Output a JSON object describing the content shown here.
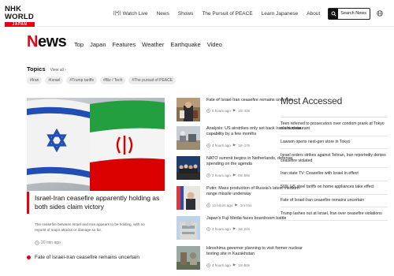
{
  "brand": {
    "logo_main": "NHK WORLD",
    "logo_sub": "JAPAN"
  },
  "topnav": {
    "watch_live": "Watch Live",
    "items": [
      "News",
      "Shows",
      "The Pursuit of PEACE",
      "Learn Japanese",
      "About"
    ],
    "search_label": "Search News"
  },
  "page": {
    "title_first": "N",
    "title_rest": "ews"
  },
  "categories": [
    "Top",
    "Japan",
    "Features",
    "Weather",
    "Earthquake",
    "Video"
  ],
  "topics": {
    "title": "Topics",
    "view_all": "View all",
    "tags": [
      "#Iran",
      "#Israel",
      "#Trump tariffs",
      "#Biz / Tech",
      "#The pursuit of PEACE"
    ]
  },
  "featured": {
    "title": "Israel-Iran ceasefire apparently holding as both sides claim victory",
    "summary": "The ceasefire between Israel and Iran appears to be holding, with no reports of major attacks or damage so far.",
    "time": "20 min ago",
    "related": "Fate of Israel-Iran ceasefire remains uncertain"
  },
  "stories": [
    {
      "title": "Fate of Israel-Iran ceasefire remains uncertain",
      "ago": "6 hours ago",
      "duration": "1m 43s",
      "thumb": "press-conference"
    },
    {
      "title": "Analysis: US airstrikes only set back Iran's nuclear capability by a few months",
      "ago": "4 hours ago",
      "duration": "1m 17s",
      "thumb": "nuclear-facility"
    },
    {
      "title": "NATO summit begins in Netherlands, defense spending on the agenda",
      "ago": "2 hours ago",
      "duration": "0m 59s",
      "thumb": "summit-leaders"
    },
    {
      "title": "Putin: Mass production of Russia's latest medium-range missile underway",
      "ago": "12 hours ago",
      "duration": "1m 01s",
      "thumb": "putin-flags"
    },
    {
      "title": "Japan's Fuji Media faces boardroom battle",
      "ago": "3 hours ago",
      "duration": "1m 24s",
      "thumb": "fuji-building"
    },
    {
      "title": "Hiroshima governor planning to visit former nuclear testing site in Kazakhstan",
      "ago": "4 hours ago",
      "duration": "1m 50s",
      "thumb": "governor-dome"
    }
  ],
  "most_accessed": {
    "title": "Most Accessed",
    "items": [
      "Teen referred to prosecutors over condom prank at Tokyo sushi restaurant",
      "Lawson opens next-gen store in Tokyo",
      "Israel orders strikes against Tehran, Iran reportedly denies ceasefire violated",
      "Iran state TV: Ceasefire with Israel in effect",
      "50% US steel tariffs on home appliances take effect",
      "Fate of Israel-Iran ceasefire remains uncertain",
      "Trump lashes out at Israel, Iran over ceasefire violations"
    ]
  },
  "colors": {
    "accent": "#e60012",
    "text": "#222222",
    "muted": "#777777"
  }
}
